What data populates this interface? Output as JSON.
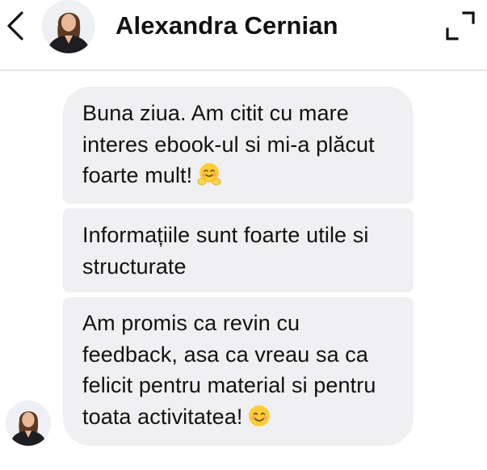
{
  "header": {
    "back_icon": "chevron-left-icon",
    "contact_name": "Alexandra Cernian",
    "expand_icon": "expand-icon"
  },
  "messages": [
    {
      "sender": "Alexandra Cernian",
      "text": "Buna ziua. Am citit cu mare interes ebook-ul si mi-a plăcut foarte mult!",
      "emoji": "hugging-face-emoji"
    },
    {
      "sender": "Alexandra Cernian",
      "text": "Informațiile sunt foarte utile si structurate",
      "emoji": ""
    },
    {
      "sender": "Alexandra Cernian",
      "text": "Am promis ca revin cu feedback, asa ca vreau sa ca felicit pentru material si pentru toata activitatea!",
      "emoji": "smiling-face-emoji"
    }
  ],
  "colors": {
    "bubble_background": "#f0f0f2",
    "text": "#111111",
    "divider": "#e6e6e8",
    "emoji_yellow": "#ffcc33"
  }
}
